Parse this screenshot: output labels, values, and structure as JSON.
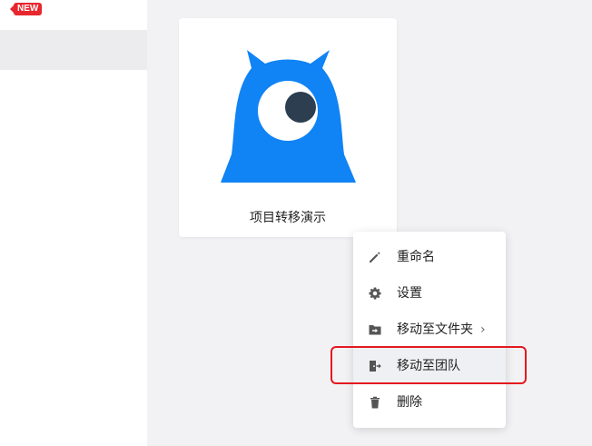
{
  "sidebar": {
    "badge": "NEW"
  },
  "project": {
    "title": "项目转移演示"
  },
  "context_menu": {
    "items": [
      {
        "label": "重命名",
        "icon": "pencil-icon"
      },
      {
        "label": "设置",
        "icon": "gear-icon"
      },
      {
        "label": "移动至文件夹",
        "icon": "folder-move-icon",
        "submenu_indicator": "›"
      },
      {
        "label": "移动至团队",
        "icon": "exit-to-team-icon"
      },
      {
        "label": "删除",
        "icon": "trash-icon"
      }
    ]
  },
  "colors": {
    "mascot_blue": "#1083f5",
    "badge_red": "#e8262d",
    "highlight_red": "#e4191f",
    "menu_hover": "#eef0f3"
  }
}
